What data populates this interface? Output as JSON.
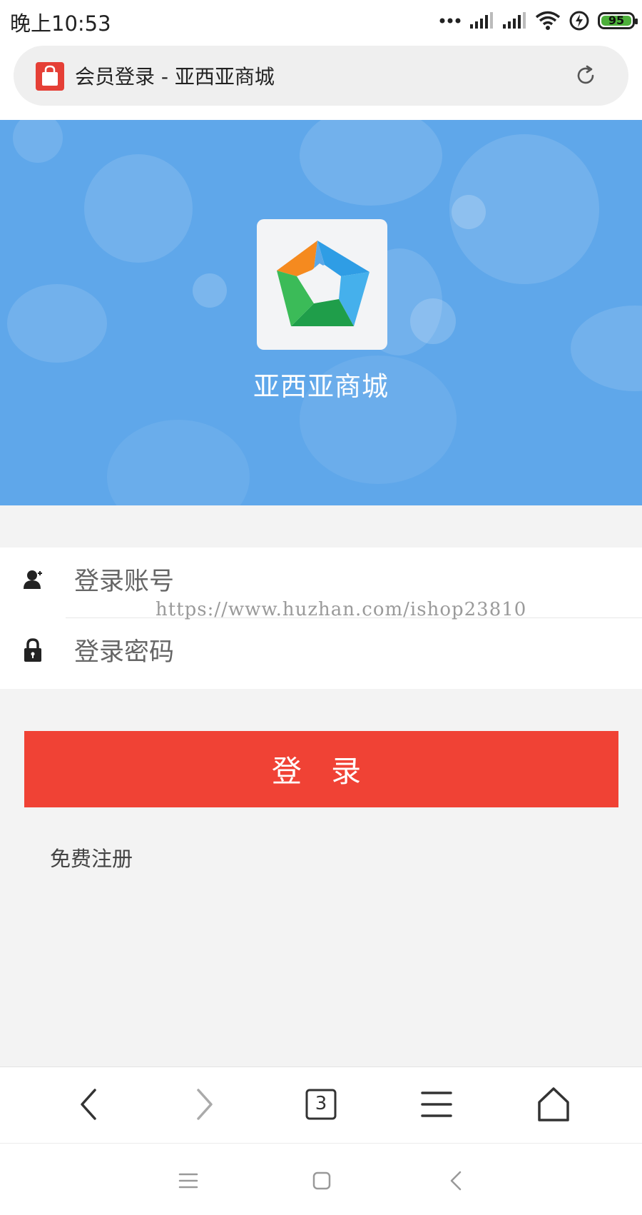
{
  "status_bar": {
    "time": "晚上10:53",
    "battery": "95",
    "icons": [
      "dots-icon",
      "signal-icon",
      "signal-icon",
      "wifi-icon",
      "charging-icon",
      "battery-icon"
    ]
  },
  "browser": {
    "page_title": "会员登录 - 亚西亚商城",
    "site_icon": "shopping-bag-icon",
    "reload_icon": "reload-icon",
    "tab_count": "3"
  },
  "banner": {
    "store_name": "亚西亚商城",
    "logo": "pentagon-logo"
  },
  "login_form": {
    "account_placeholder": "登录账号",
    "password_placeholder": "登录密码",
    "watermark": "https://www.huzhan.com/ishop23810",
    "submit_label": "登 录",
    "register_link": "免费注册"
  },
  "colors": {
    "banner_blue": "#5fa7ea",
    "button_red": "#f04235",
    "site_icon_red": "#e53f36"
  }
}
